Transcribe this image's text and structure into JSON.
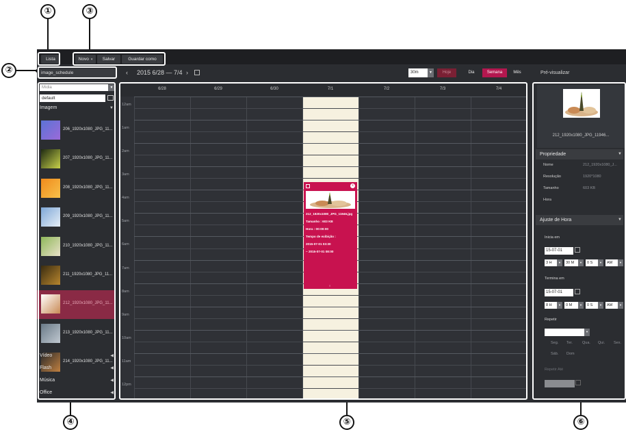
{
  "callouts": [
    "①",
    "②",
    "③",
    "④",
    "⑤",
    "⑥"
  ],
  "toolbar": {
    "list_label": "Lista",
    "new_label": "Novo",
    "save_label": "Salvar",
    "save_as_label": "Guardar como"
  },
  "schedule_name": "image_schedule",
  "calendar": {
    "range": "2015 6/28 — 7/4",
    "prev": "‹",
    "next": "›",
    "interval": "30m",
    "views": {
      "today": "Hoje",
      "day": "Dia",
      "week": "Semana",
      "month": "Mês"
    },
    "days": [
      "6/28",
      "6/29",
      "6/30",
      "7/1",
      "7/2",
      "7/3",
      "7/4"
    ],
    "hours": [
      "12am",
      "1am",
      "2am",
      "3am",
      "4am",
      "5am",
      "6am",
      "7am",
      "8am",
      "9am",
      "10am",
      "11am",
      "12pm"
    ],
    "today_index": 3
  },
  "event": {
    "filename": "212_1920x1080_JPG_11946.jpg",
    "size": "Tamanho : 603 KB",
    "time": "Hora : 00:00:00",
    "display_time": "Tempo de exibição :",
    "start": "2015-07-01 03:30",
    "end": "~ 2015-07-01 08:00"
  },
  "left": {
    "media_placeholder": "Mídia",
    "folder": "default",
    "category_image": "Imagem",
    "items": [
      {
        "label": "206_1920x1080_JPG_11..."
      },
      {
        "label": "207_1920x1080_JPG_11..."
      },
      {
        "label": "208_1920x1080_JPG_11..."
      },
      {
        "label": "209_1920x1080_JPG_11..."
      },
      {
        "label": "210_1920x1080_JPG_11..."
      },
      {
        "label": "211_1920x1080_JPG_11..."
      },
      {
        "label": "212_1920x1080_JPG_11..."
      },
      {
        "label": "213_1920x1080_JPG_11..."
      },
      {
        "label": "214_1920x1080_JPG_11..."
      }
    ],
    "selected_index": 6,
    "categories": [
      "Vídeo",
      "Flash",
      "Música",
      "Office"
    ]
  },
  "right": {
    "title": "Pré-visualizar",
    "preview_name": "212_1920x1080_JPG_11946...",
    "property_header": "Propriedade",
    "props": [
      {
        "k": "Nome",
        "v": "212_1920x1080_J..."
      },
      {
        "k": "Resolução",
        "v": "1920*1080"
      },
      {
        "k": "Tamanho",
        "v": "603 KB"
      },
      {
        "k": "Hora",
        "v": ""
      }
    ],
    "time_header": "Ajuste de Hora",
    "start_label": "Inicia em",
    "start_date": "15-07-01",
    "start_h": "3 H",
    "start_m": "30 M",
    "start_s": "0 S",
    "start_ampm": "AM",
    "end_label": "Termina em",
    "end_date": "15-07-01",
    "end_h": "8 H",
    "end_m": "0 M",
    "end_s": "0 S",
    "end_ampm": "AM",
    "repeat_label": "Repetir",
    "weekdays": [
      "Seg.",
      "Ter.",
      "Qua.",
      "Qui.",
      "Sex.",
      "Sáb.",
      "Dom"
    ],
    "repeat_until_label": "Repetir Até"
  },
  "colors": {
    "accent": "#c8124f",
    "today_column": "#f6f1e0",
    "panel_bg": "#2b2d31"
  }
}
